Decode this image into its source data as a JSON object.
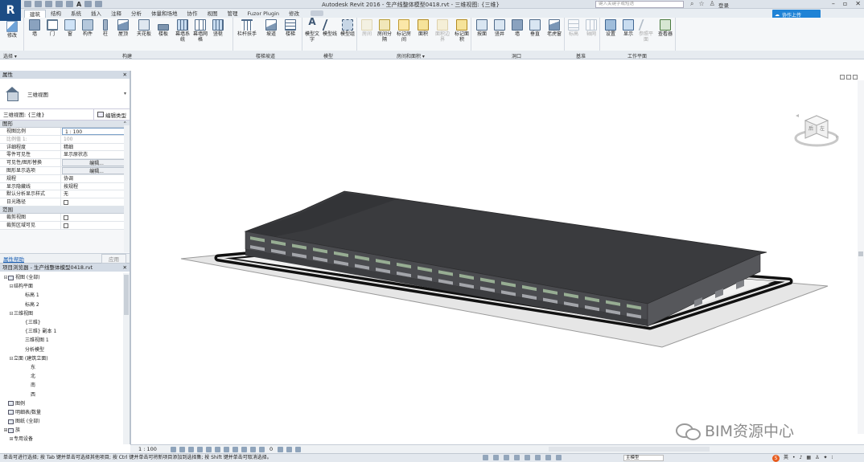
{
  "app": {
    "logo_letter": "R",
    "title": "Autodesk Revit 2016 -     生产线整体模型0418.rvt - 三维视图: {三维}",
    "search_placeholder": "键入关键字或短语",
    "login": "登录",
    "qat_letter": "A"
  },
  "ribbon": {
    "tabs": [
      "建筑",
      "结构",
      "系统",
      "插入",
      "注释",
      "分析",
      "体量和场地",
      "协作",
      "视图",
      "管理",
      "Fuzor Plugin",
      "修改"
    ],
    "active_tab": "建筑",
    "cloud_label": "协作上传",
    "tools": {
      "modify": "修改",
      "wall": "墙",
      "door": "门",
      "window": "窗",
      "component": "构件",
      "column": "柱",
      "roof": "屋顶",
      "ceiling": "天花板",
      "floor": "楼板",
      "curtain_system": "幕墙系统",
      "curtain_grid": "幕墙网格",
      "mullion": "竖梃",
      "railing": "栏杆扶手",
      "ramp": "坡道",
      "stair": "楼梯",
      "model_text": "模型文字",
      "model_line": "模型线",
      "model_group": "模型组",
      "room": "房间",
      "room_sep": "房间分隔",
      "tag_room": "标记房间",
      "area": "面积",
      "area_boundary": "面积边界",
      "tag_area": "标记面积",
      "by_face": "按面",
      "shaft": "竖井",
      "wall_open": "墙",
      "vertical": "垂直",
      "dormer": "老虎窗",
      "level": "标高",
      "grid": "轴网",
      "set": "设置",
      "show": "显示",
      "ref_plane": "参照平面",
      "viewer": "查看器"
    },
    "panels": {
      "select": "选择 ▾",
      "build": "构建",
      "circulation": "楼梯坡道",
      "model": "模型",
      "room_area": "房间和面积 ▾",
      "opening": "洞口",
      "datum": "基准",
      "work_plane": "工作平面"
    }
  },
  "properties": {
    "header": "属性",
    "type_name": "三维视图",
    "instance_selector": "三维视图: {三维}",
    "edit_type": "编辑类型",
    "group_graphics": "图形",
    "rows": [
      {
        "name": "视图比例",
        "value": "1 : 100",
        "style": "boxed"
      },
      {
        "name": "比例值 1:",
        "value": "100",
        "style": "dim"
      },
      {
        "name": "详细程度",
        "value": "精细",
        "style": ""
      },
      {
        "name": "零件可见性",
        "value": "显示原状态",
        "style": ""
      },
      {
        "name": "可见性/图形替换",
        "value": "编辑...",
        "style": "btn"
      },
      {
        "name": "图形显示选项",
        "value": "编辑...",
        "style": "btn"
      },
      {
        "name": "规程",
        "value": "协调",
        "style": ""
      },
      {
        "name": "显示隐藏线",
        "value": "按规程",
        "style": ""
      },
      {
        "name": "默认分析显示样式",
        "value": "无",
        "style": ""
      },
      {
        "name": "日光路径",
        "value": "",
        "style": "check"
      }
    ],
    "group_extents": "范围",
    "extent_rows": [
      {
        "name": "裁剪视图",
        "value": "",
        "style": "check"
      },
      {
        "name": "裁剪区域可见",
        "value": "",
        "style": "check"
      }
    ],
    "help_link": "属性帮助",
    "apply": "应用"
  },
  "browser": {
    "header": "项目浏览器 - 生产线整体模型0418.rvt",
    "items": [
      {
        "label": "视图 (全部)",
        "level": 0,
        "toggle": "⊟",
        "icon": true
      },
      {
        "label": "结构平面",
        "level": 1,
        "toggle": "⊟",
        "icon": false
      },
      {
        "label": "标高 1",
        "level": 3,
        "toggle": "",
        "icon": false
      },
      {
        "label": "标高 2",
        "level": 3,
        "toggle": "",
        "icon": false
      },
      {
        "label": "三维视图",
        "level": 1,
        "toggle": "⊟",
        "icon": false
      },
      {
        "label": "{三维}",
        "level": 3,
        "toggle": "",
        "icon": false
      },
      {
        "label": "{三维} 副本 1",
        "level": 3,
        "toggle": "",
        "icon": false
      },
      {
        "label": "三维视图 1",
        "level": 3,
        "toggle": "",
        "icon": false
      },
      {
        "label": "分析模型",
        "level": 3,
        "toggle": "",
        "icon": false
      },
      {
        "label": "立面 (建筑立面)",
        "level": 1,
        "toggle": "⊟",
        "icon": false
      },
      {
        "label": "东",
        "level": 4,
        "toggle": "",
        "icon": false
      },
      {
        "label": "北",
        "level": 4,
        "toggle": "",
        "icon": false
      },
      {
        "label": "南",
        "level": 4,
        "toggle": "",
        "icon": false
      },
      {
        "label": "西",
        "level": 4,
        "toggle": "",
        "icon": false
      },
      {
        "label": "图例",
        "level": 0,
        "toggle": "",
        "icon": true
      },
      {
        "label": "明细表/数量",
        "level": 0,
        "toggle": "",
        "icon": true
      },
      {
        "label": "图纸 (全部)",
        "level": 0,
        "toggle": "",
        "icon": true
      },
      {
        "label": "族",
        "level": 0,
        "toggle": "⊞",
        "icon": true
      },
      {
        "label": "专用设备",
        "level": 1,
        "toggle": "⊞",
        "icon": false
      }
    ]
  },
  "viewcube": {
    "left_face": "后",
    "right_face": "左"
  },
  "viewbar": {
    "scale": "1 : 100",
    "count": "0"
  },
  "status": {
    "message": "单击可进行选择; 按 Tab 键并单击可选择其他项目; 按 Ctrl 键并单击可将新项目添加到选择集; 按 Shift 键并单击可取消选择。",
    "model": "主模型",
    "ime": "英"
  },
  "watermark": "BIM资源中心"
}
